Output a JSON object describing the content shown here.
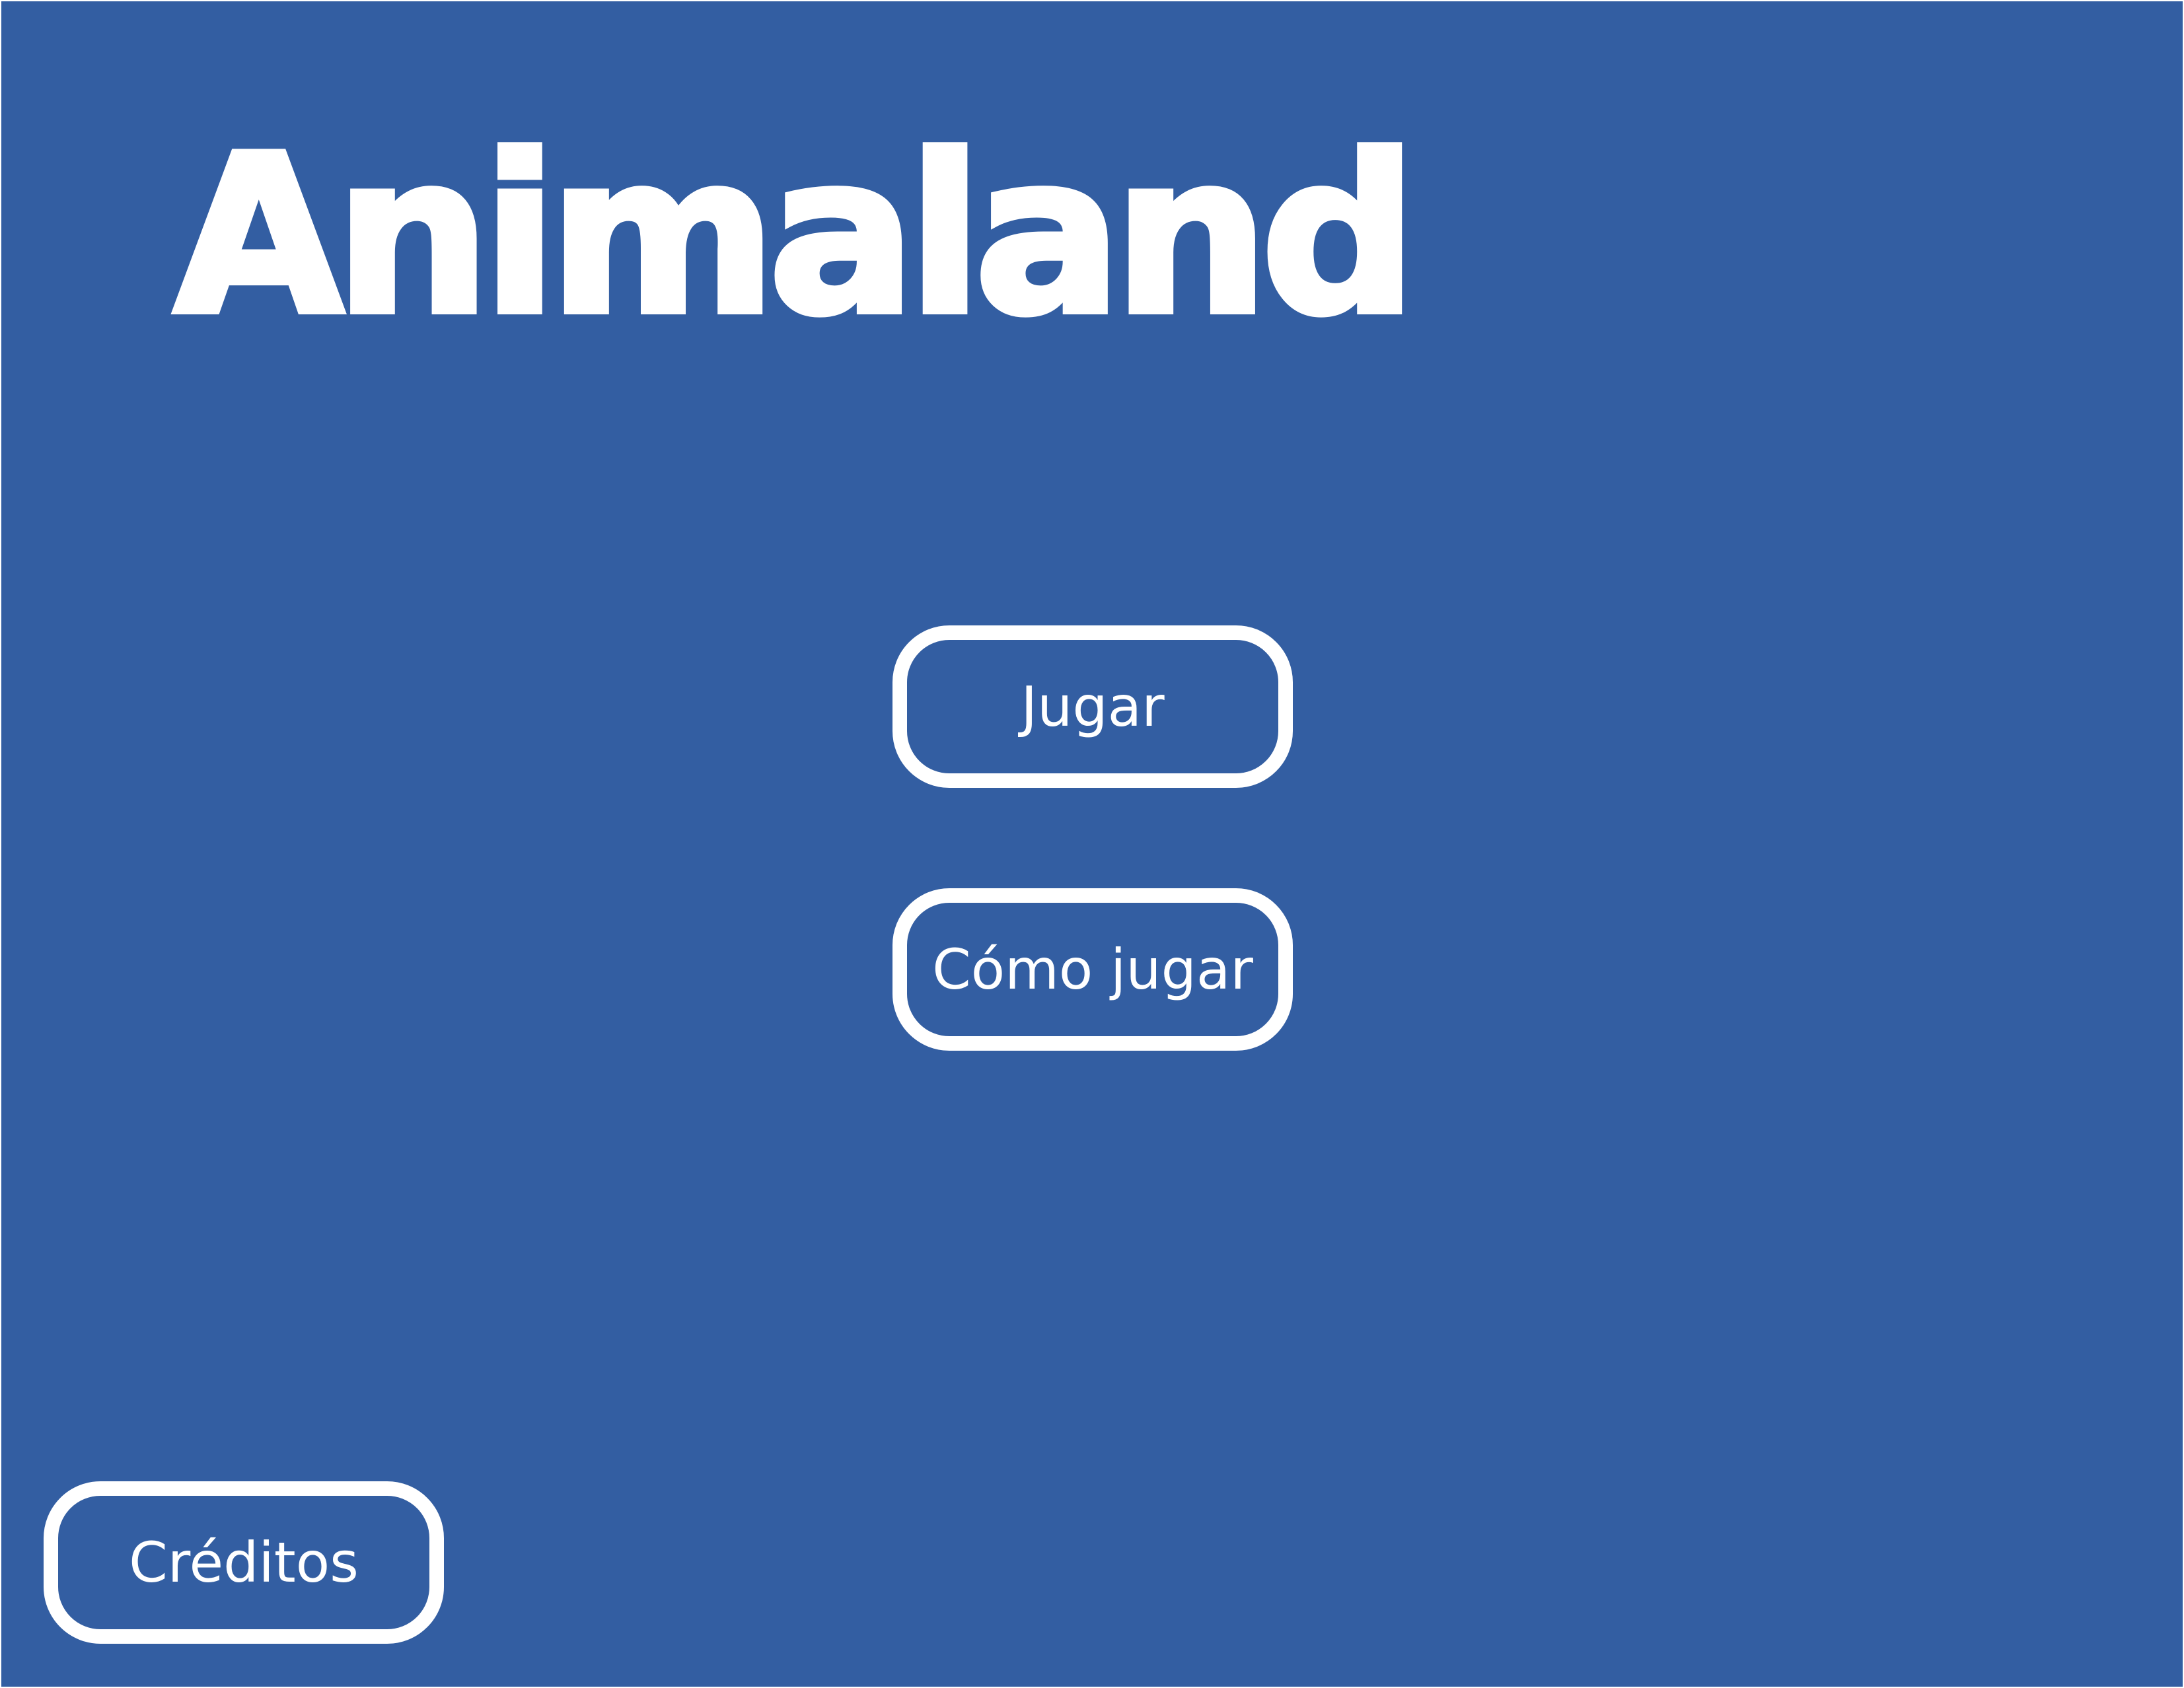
{
  "game": {
    "title": "Animaland"
  },
  "menu": {
    "play_label": "Jugar",
    "how_to_play_label": "Cómo jugar",
    "credits_label": "Créditos"
  },
  "colors": {
    "background": "#335ea2",
    "foreground": "#ffffff"
  }
}
